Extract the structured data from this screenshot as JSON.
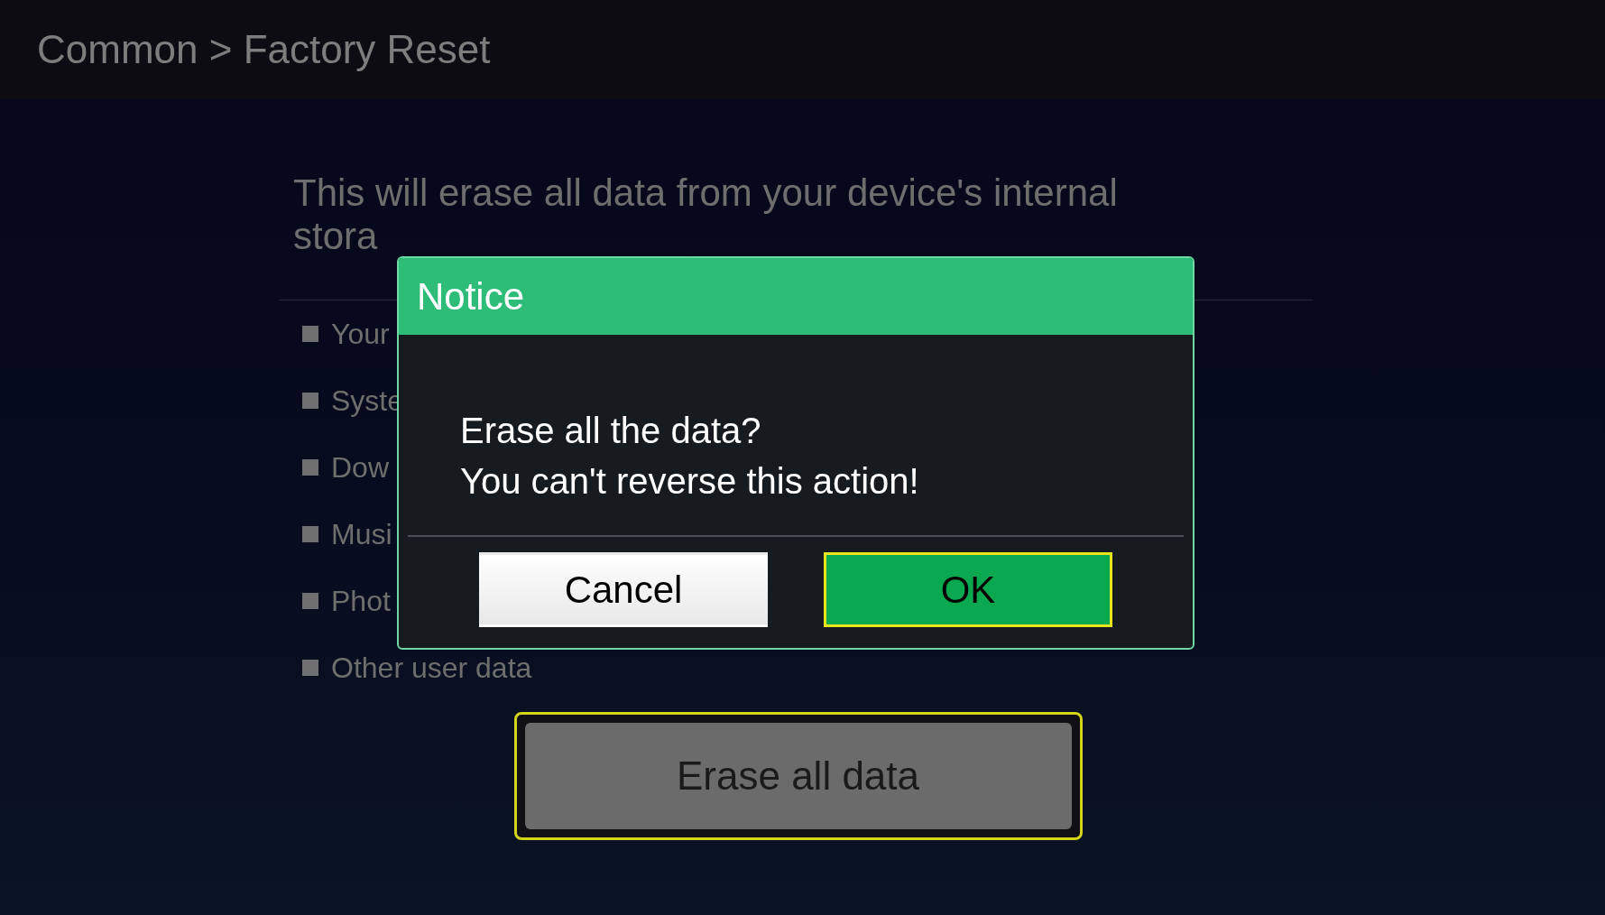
{
  "header": {
    "title": "Common > Factory Reset"
  },
  "intro": "This will erase all data from your device's internal stora",
  "items": [
    "Your",
    "Syste",
    "Dow",
    "Musi",
    "Phot",
    "Other user data"
  ],
  "erase_button": {
    "label": "Erase all data",
    "focused": true
  },
  "dialog": {
    "title": "Notice",
    "message": [
      "Erase all the data?",
      "You can't reverse this action!"
    ],
    "buttons": [
      {
        "label": "Cancel",
        "kind": "secondary",
        "focused": false
      },
      {
        "label": "OK",
        "kind": "primary",
        "focused": true
      }
    ]
  }
}
